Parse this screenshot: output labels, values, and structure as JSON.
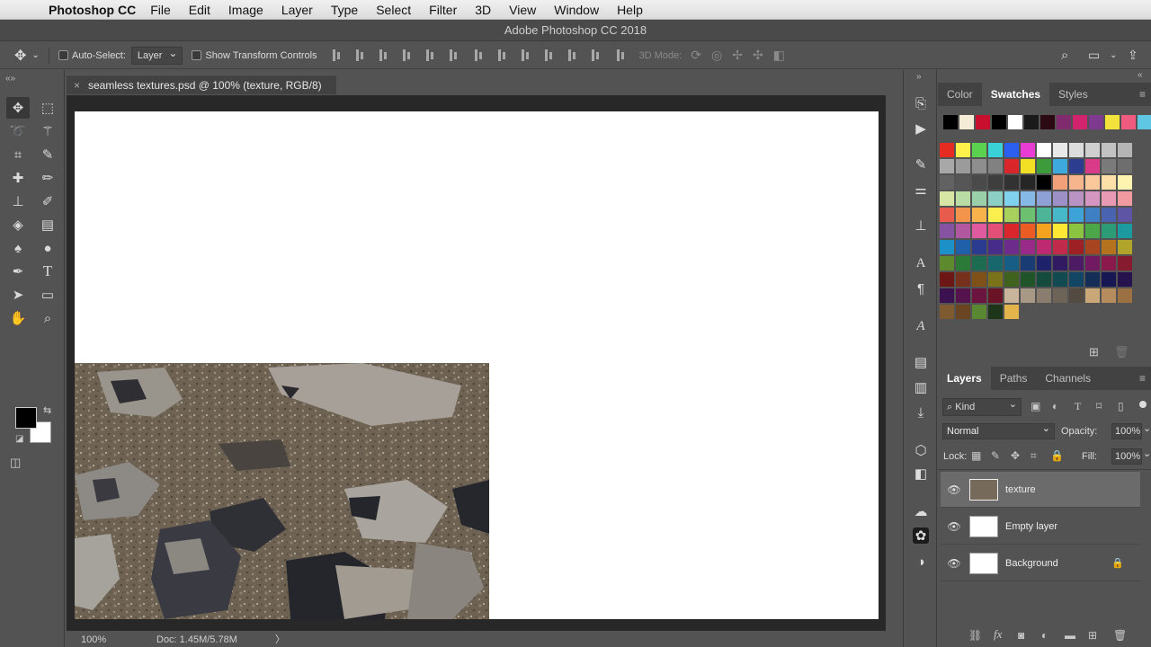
{
  "menubar": {
    "app_name": "Photoshop CC",
    "items": [
      "File",
      "Edit",
      "Image",
      "Layer",
      "Type",
      "Select",
      "Filter",
      "3D",
      "View",
      "Window",
      "Help"
    ]
  },
  "window": {
    "title": "Adobe Photoshop CC 2018"
  },
  "options": {
    "auto_select_label": "Auto-Select:",
    "auto_select_value": "Layer",
    "transform_label": "Show Transform Controls",
    "mode_3d_label": "3D Mode:"
  },
  "document": {
    "tab_title": "seamless textures.psd @ 100% (texture, RGB/8)"
  },
  "status": {
    "zoom": "100%",
    "doc_size": "Doc: 1.45M/5.78M",
    "arrow": "〉"
  },
  "color_panel": {
    "tabs": [
      "Color",
      "Swatches",
      "Styles"
    ],
    "active": "Swatches"
  },
  "swatches": {
    "recent": [
      "#000000",
      "#f5ecd8",
      "#c8102e",
      "#000000",
      "#ffffff",
      "#1a1a1a",
      "#2b0a14",
      "#7f2b6e",
      "#d1236e",
      "#7e3a8f",
      "#f3e23b",
      "#ee5b7f",
      "#5fc6e3"
    ],
    "grid": [
      [
        "#e52b22",
        "#fff04a",
        "#5bd24f",
        "#39d2d6",
        "#2a5ff1",
        "#e83cd4",
        "#ffffff",
        "#e8e8e8",
        "#dcdcdc",
        "#cfcfcf",
        "#c2c2c2",
        "#b5b5b5"
      ],
      [
        "#a8a8a8",
        "#9b9b9b",
        "#8e8e8e",
        "#818181",
        "#d8262a",
        "#f2e024",
        "#3d9b3b",
        "#3ea9dd",
        "#2c3c8f",
        "#d93b88",
        "#7a7a7a",
        "#6e6e6e"
      ],
      [
        "#626262",
        "#565656",
        "#4a4a4a",
        "#3e3e3e",
        "#323232",
        "#262626",
        "#000000",
        "#f2a07a",
        "#f7b58e",
        "#fbc89b",
        "#fde0a8",
        "#fff3b0"
      ],
      [
        "#d8e6a5",
        "#b9dba4",
        "#99d0a9",
        "#8ccfc4",
        "#7fd1ee",
        "#86b8e6",
        "#8ea1d6",
        "#9d90c7",
        "#b893c4",
        "#d597c2",
        "#e89ab5",
        "#f19aa0"
      ],
      [
        "#e75c4c",
        "#f3944c",
        "#f8b34c",
        "#fbef4f",
        "#a8d05c",
        "#6cc070",
        "#4db597",
        "#47b8c8",
        "#3ea3d9",
        "#3f80c5",
        "#4a63b0",
        "#5e55a4"
      ],
      [
        "#8553a2",
        "#b258a1",
        "#e05aa0",
        "#e44f77",
        "#d9262c",
        "#eb5b24",
        "#f5a21f",
        "#fde834",
        "#8bc440",
        "#4ba748",
        "#2d9b75",
        "#1c9a9f"
      ],
      [
        "#1e90c8",
        "#2060aa",
        "#2b3b8f",
        "#472c8a",
        "#6d2b8b",
        "#9a2a8a",
        "#bd2a72",
        "#c12a4a",
        "#9e2025",
        "#a84520",
        "#b57320",
        "#b0a52a"
      ],
      [
        "#5e8a2e",
        "#2c7a37",
        "#1d6b50",
        "#17676d",
        "#175e86",
        "#193c74",
        "#1d226a",
        "#321a63",
        "#4d1b64",
        "#711a62",
        "#8a1a4c",
        "#861a2e"
      ],
      [
        "#6c1715",
        "#76301b",
        "#7d5118",
        "#7a7319",
        "#40621f",
        "#1f5529",
        "#154b3c",
        "#124a52",
        "#134565",
        "#152e58",
        "#171853",
        "#26134e"
      ],
      [
        "#3b124f",
        "#54134d",
        "#6b1440",
        "#6b1326",
        "#c8b59b",
        "#a89886",
        "#8a7d6d",
        "#6e6357",
        "#534a41",
        "#c9a779",
        "#b48c5d",
        "#9b7143"
      ],
      [
        "#7f5930",
        "#6a4522",
        "#5a8731",
        "#1d3519",
        "#e2b44b",
        "#535353"
      ]
    ]
  },
  "layers_panel": {
    "tabs": [
      "Layers",
      "Paths",
      "Channels"
    ],
    "active": "Layers",
    "kind_label": "Kind",
    "blend_mode": "Normal",
    "opacity_label": "Opacity:",
    "opacity_value": "100%",
    "lock_label": "Lock:",
    "fill_label": "Fill:",
    "fill_value": "100%",
    "layers": [
      {
        "name": "texture",
        "selected": true
      },
      {
        "name": "Empty layer",
        "selected": false
      },
      {
        "name": "Background",
        "selected": false,
        "locked": true
      }
    ]
  }
}
